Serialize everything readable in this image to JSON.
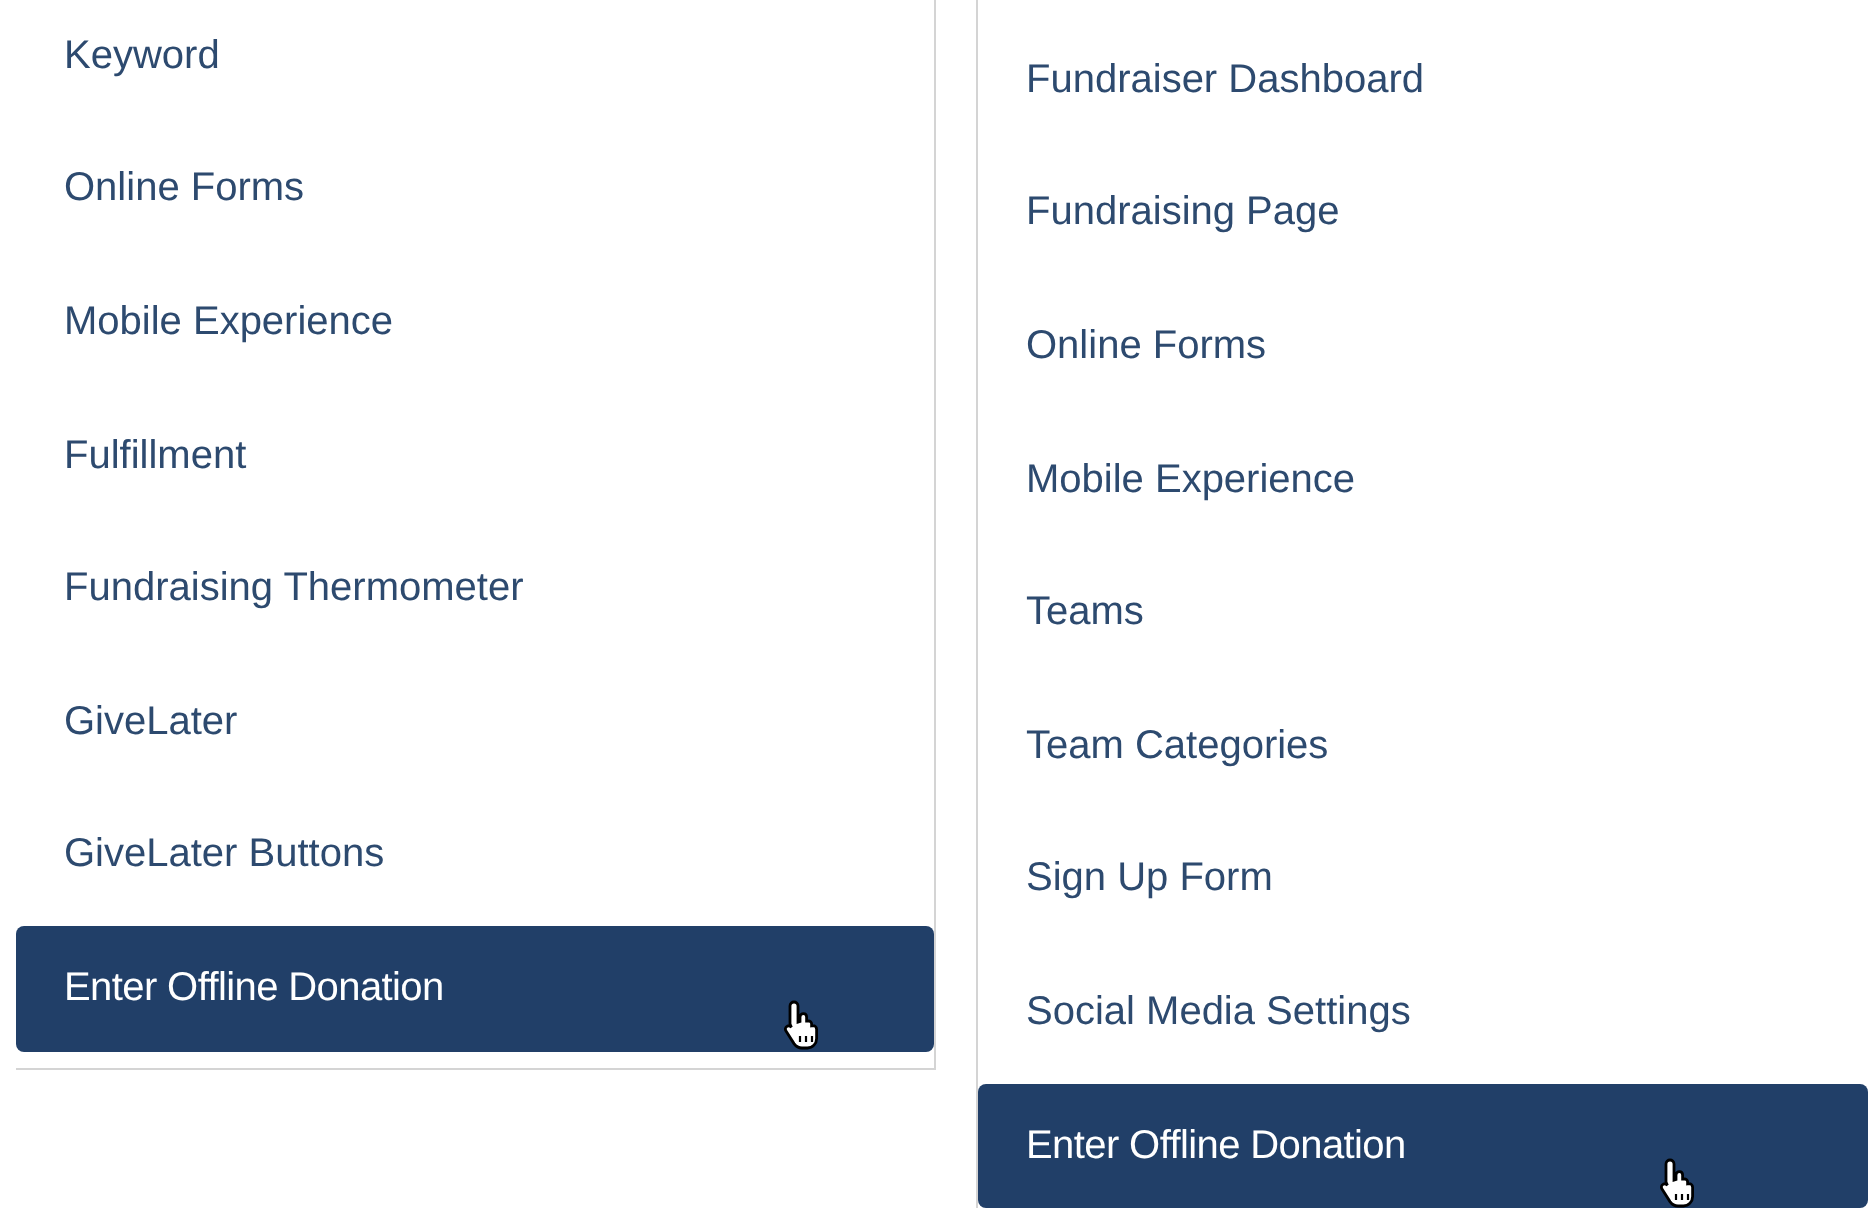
{
  "left_menu": {
    "items": [
      {
        "label": "Keyword",
        "selected": false
      },
      {
        "label": "Online Forms",
        "selected": false
      },
      {
        "label": "Mobile Experience",
        "selected": false
      },
      {
        "label": "Fulfillment",
        "selected": false
      },
      {
        "label": "Fundraising Thermometer",
        "selected": false
      },
      {
        "label": "GiveLater",
        "selected": false
      },
      {
        "label": "GiveLater Buttons",
        "selected": false
      },
      {
        "label": "Enter Offline Donation",
        "selected": true
      }
    ]
  },
  "right_menu": {
    "items": [
      {
        "label": "Fundraiser Dashboard",
        "selected": false
      },
      {
        "label": "Fundraising Page",
        "selected": false
      },
      {
        "label": "Online Forms",
        "selected": false
      },
      {
        "label": "Mobile Experience",
        "selected": false
      },
      {
        "label": "Teams",
        "selected": false
      },
      {
        "label": "Team Categories",
        "selected": false
      },
      {
        "label": "Sign Up Form",
        "selected": false
      },
      {
        "label": "Social Media Settings",
        "selected": false
      },
      {
        "label": "Enter Offline Donation",
        "selected": true
      }
    ]
  }
}
